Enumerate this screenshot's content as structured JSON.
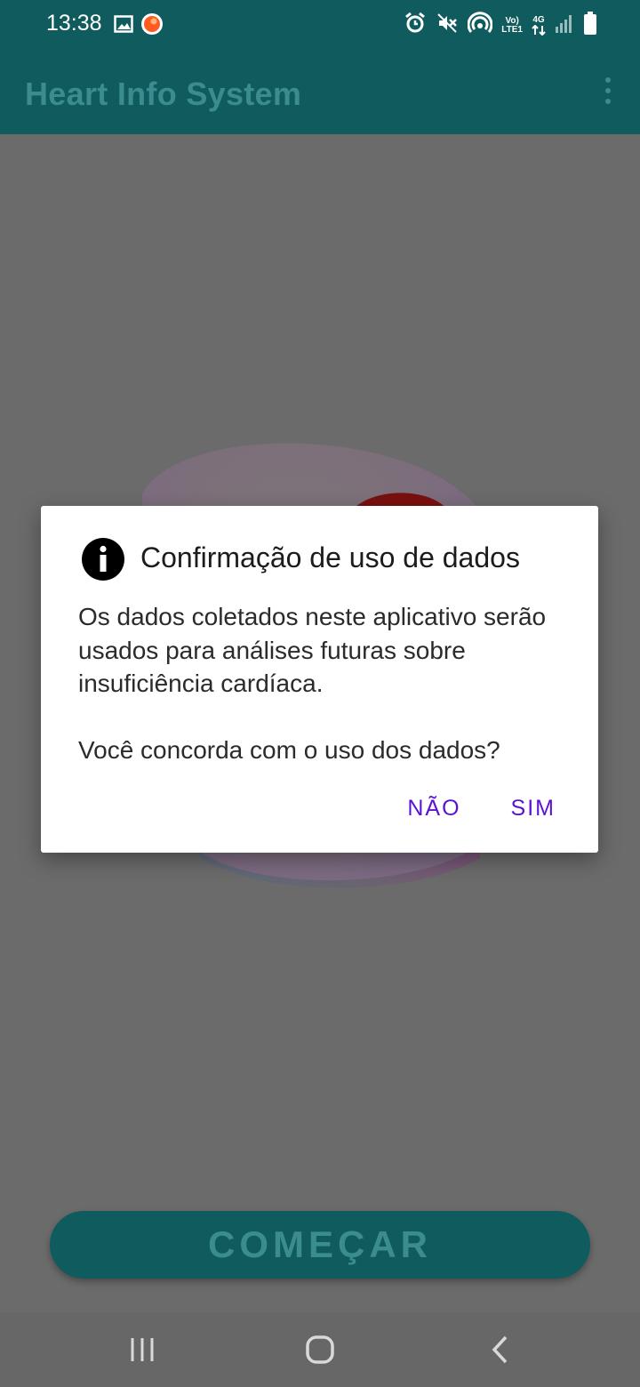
{
  "status_bar": {
    "time": "13:38",
    "network_label_top": "Vo)",
    "network_label_bottom": "LTE1",
    "data_label": "4G",
    "icons": [
      "gallery-icon",
      "notification-app-icon",
      "alarm-icon",
      "mute-icon",
      "hotspot-icon",
      "volte-icon",
      "4g-data-icon",
      "signal-icon",
      "battery-icon"
    ]
  },
  "app_bar": {
    "title": "Heart Info System",
    "menu_icon": "overflow-menu-icon"
  },
  "dialog": {
    "title": "Confirmação de uso de dados",
    "icon": "info-icon",
    "message": "Os dados coletados neste aplicativo serão usados para análises futuras sobre insuficiência cardíaca.\n\n Você concorda com o uso dos dados?",
    "negative_label": "NÃO",
    "positive_label": "SIM"
  },
  "main": {
    "start_button_label": "COMEÇAR"
  },
  "nav_bar": {
    "icons": [
      "recent-apps-icon",
      "home-icon",
      "back-icon"
    ]
  },
  "colors": {
    "app_bar_dimmed": "#0f5b5e",
    "dialog_button": "#5b12d4",
    "scrim": "#6b6b6b"
  }
}
